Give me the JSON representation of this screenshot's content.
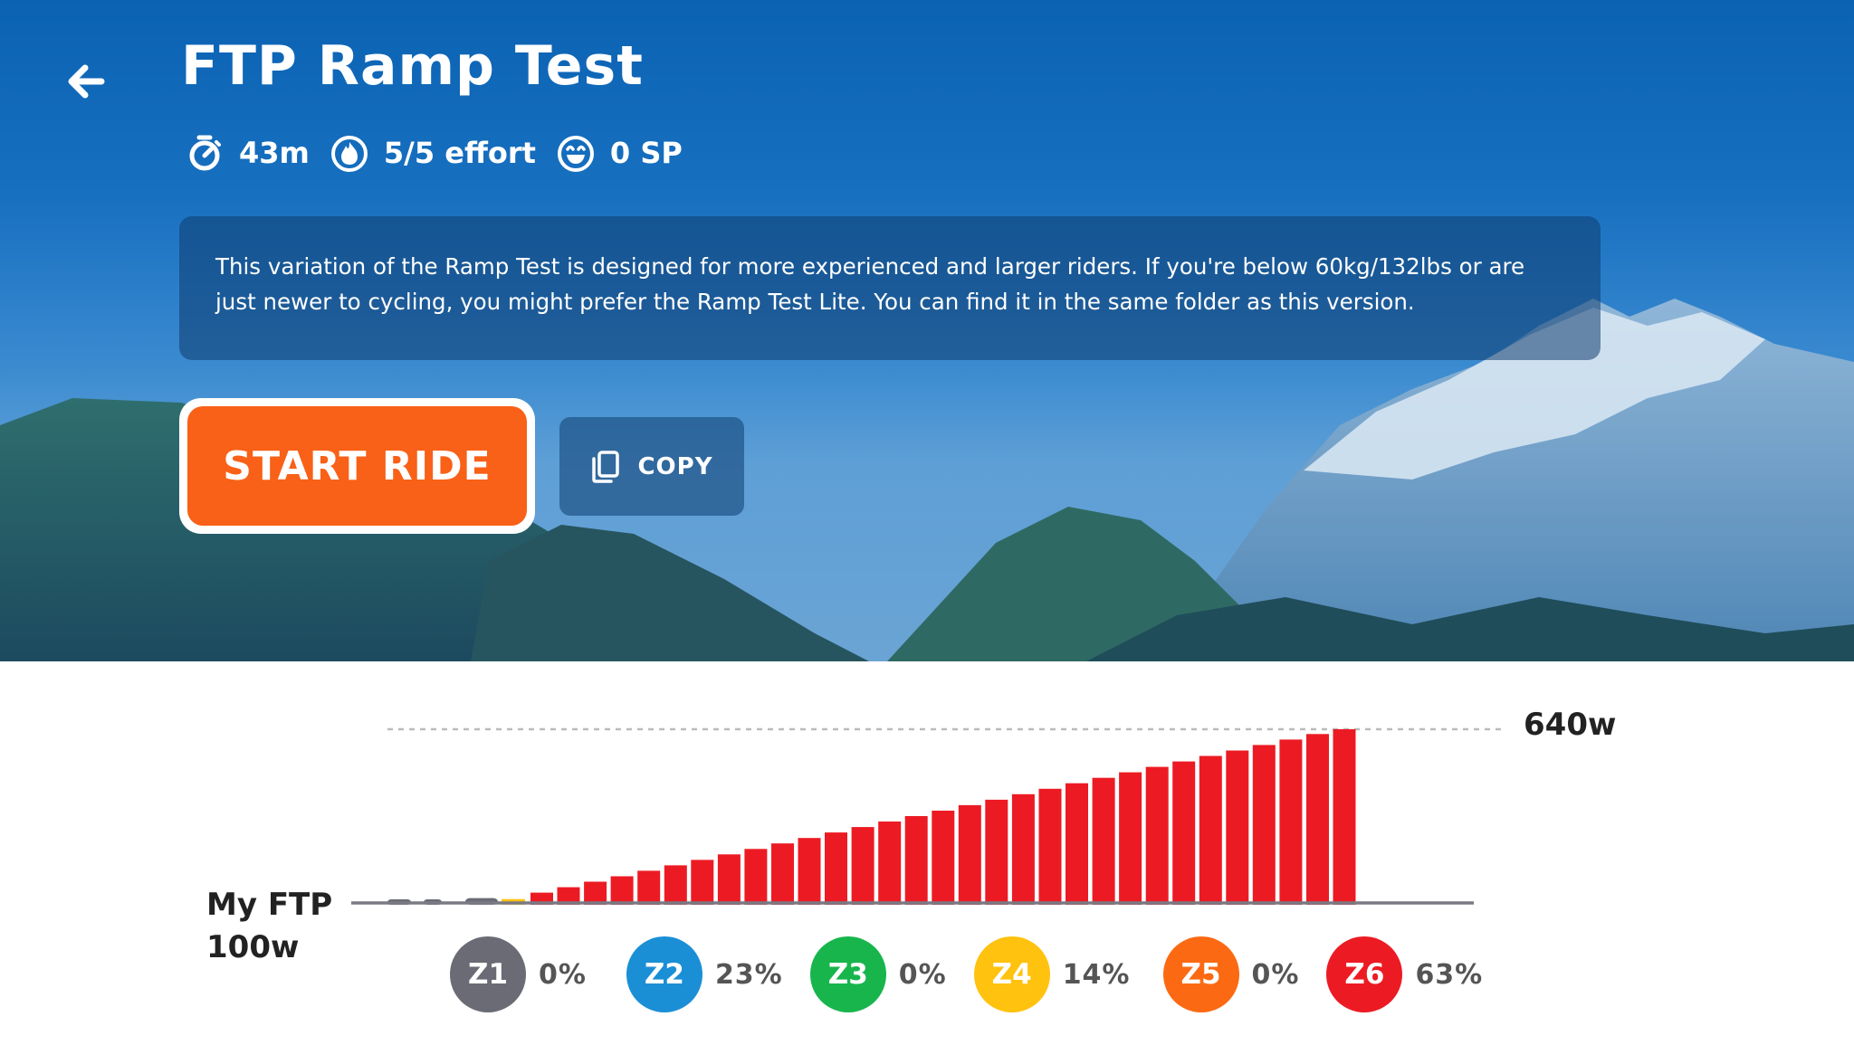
{
  "header": {
    "title": "FTP Ramp Test",
    "back_icon": "arrow-left-icon"
  },
  "meta": [
    {
      "icon": "stopwatch-icon",
      "text": "43m"
    },
    {
      "icon": "flame-icon",
      "text": "5/5 effort"
    },
    {
      "icon": "smiley-icon",
      "text": "0 SP"
    }
  ],
  "description": "This variation of the Ramp Test is designed for more experienced and larger riders. If you're below 60kg/132lbs or are just newer to cycling, you might prefer the Ramp Test Lite. You can find it in the same folder as this version.",
  "actions": {
    "start_ride": "START RIDE",
    "copy": "COPY",
    "copy_icon": "copy-icon",
    "start_color": "#f86117"
  },
  "chart_data": {
    "type": "bar",
    "max_label": "640w",
    "ftp_label_line1": "My FTP",
    "ftp_label_line2": "100w",
    "ftp_watts": 100,
    "max_watts": 640,
    "warmup_steps": [
      {
        "watts": 107,
        "zone": "Z1"
      },
      {
        "watts": 107,
        "zone": "Z1"
      },
      {
        "watts": 115,
        "zone": "Z1"
      },
      {
        "watts": 112,
        "zone": "Z4"
      }
    ],
    "ramp_watts": [
      132,
      149,
      166,
      183,
      200,
      217,
      234,
      251,
      268,
      285,
      302,
      319,
      336,
      353,
      370,
      387,
      404,
      421,
      438,
      455,
      472,
      489,
      506,
      523,
      540,
      557,
      574,
      591,
      608,
      625,
      640
    ],
    "ramp_zone": "Z6",
    "zones": [
      {
        "label": "Z1",
        "percent": "0%",
        "color": "#6b6b75"
      },
      {
        "label": "Z2",
        "percent": "23%",
        "color": "#1b8fd6"
      },
      {
        "label": "Z3",
        "percent": "0%",
        "color": "#18b54d"
      },
      {
        "label": "Z4",
        "percent": "14%",
        "color": "#ffc20e"
      },
      {
        "label": "Z5",
        "percent": "0%",
        "color": "#fb6a13"
      },
      {
        "label": "Z6",
        "percent": "63%",
        "color": "#ec1b23"
      }
    ]
  }
}
